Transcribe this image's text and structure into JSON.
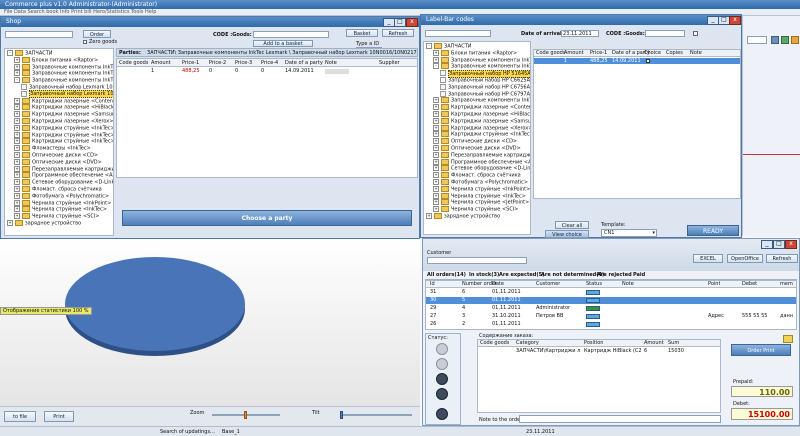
{
  "main_title": "Commerce plus v1.0  Administrator-(Administrator)",
  "main_menu": "File  Data  Search book  Info  Print bill  Hero/Statistics  Tools  Help",
  "shop": {
    "title": "Shop",
    "order_btn": "Order",
    "zero_goods": "Zero goods",
    "code_label": "CODE :Goods:",
    "add_basket": "Add to a basket",
    "basket": "Basket",
    "refresh": "Refresh",
    "type_label": "Type a ID",
    "type_value": "12345",
    "parties_label": "Parties:",
    "path": "ЗАПЧАСТИ\\ Заправочные компоненты InkTec Lexmark \\ Заправочный набор Lexmark 10N0016/10N0217 InkTec (черный) 2x",
    "columns": [
      "Code goods",
      "Amount",
      "Price-1",
      "Price-2",
      "Price-3",
      "Price-4",
      "Date of a party",
      "Note",
      "Supplier"
    ],
    "row": [
      "1",
      "",
      "488,25",
      "0",
      "0",
      "0",
      "14.09.2011",
      "",
      ""
    ],
    "choose_party": "Choose a party",
    "tree": [
      {
        "label": "ЗАПЧАСТИ",
        "level": 0,
        "exp": "-"
      },
      {
        "label": "Блоки питания <Raptor>",
        "level": 1,
        "exp": "+"
      },
      {
        "label": "Заправочные компоненты InkTec <Can",
        "level": 1,
        "exp": "+"
      },
      {
        "label": "Заправочные компоненты InkTec <HP>",
        "level": 1,
        "exp": "+"
      },
      {
        "label": "Заправочные компоненты InkTec <Lexm",
        "level": 1,
        "exp": "-"
      },
      {
        "label": "Заправочный набор Lexmark 10N001",
        "level": 2,
        "exp": ""
      },
      {
        "label": "Заправочный набор Lexmark 10N001",
        "level": 2,
        "exp": "",
        "selected": true
      },
      {
        "label": "Картриджи лазерные <Content>",
        "level": 1,
        "exp": "+"
      },
      {
        "label": "Картриджи лазерные <HiBlack>",
        "level": 1,
        "exp": "+"
      },
      {
        "label": "Картриджи лазерные <Samsung>",
        "level": 1,
        "exp": "+"
      },
      {
        "label": "Картриджи лазерные <Xerox>",
        "level": 1,
        "exp": "+"
      },
      {
        "label": "Картриджи струйные <InkTec>",
        "level": 1,
        "exp": "+"
      },
      {
        "label": "Картриджи струйные <InkTec>",
        "level": 1,
        "exp": "+"
      },
      {
        "label": "Картриджи струйные <InkTec>",
        "level": 1,
        "exp": "+"
      },
      {
        "label": "Фломастеры <InkTec>",
        "level": 1,
        "exp": "+"
      },
      {
        "label": "Оптические диски <CD>",
        "level": 1,
        "exp": "+"
      },
      {
        "label": "Оптические диски <DVD>",
        "level": 1,
        "exp": "+"
      },
      {
        "label": "Перезаправляемые картриджи <Epson",
        "level": 1,
        "exp": "+"
      },
      {
        "label": "Программное обеспечение <Антивирусы",
        "level": 1,
        "exp": "+"
      },
      {
        "label": "Сетевое оборудование <D-Link>",
        "level": 1,
        "exp": "+"
      },
      {
        "label": "Фломаст. сброса счётчика",
        "level": 1,
        "exp": "+"
      },
      {
        "label": "Фотобумага <Polychromatic>",
        "level": 1,
        "exp": "+"
      },
      {
        "label": "Чернила струйные <InkPoint>",
        "level": 1,
        "exp": "+"
      },
      {
        "label": "Чернила струйные <InkTec>",
        "level": 1,
        "exp": "+"
      },
      {
        "label": "Чернила струйные <SCI>",
        "level": 1,
        "exp": "+"
      },
      {
        "label": "зарядное устройство",
        "level": 0,
        "exp": "+"
      }
    ]
  },
  "label": {
    "title": "Label-Bar codes",
    "date_label": "Date of arrival",
    "date_value": "23.11.2011",
    "code_label": "CODE :Goods:",
    "columns": [
      "Code goods",
      "Amount",
      "Price-1",
      "Date of a party",
      "Choice",
      "Copies",
      "Note"
    ],
    "row": [
      "1",
      "1",
      "488,25",
      "14.09.2011",
      "",
      "",
      ""
    ],
    "clear_all": "Clear all",
    "view_choice": "View choice",
    "template_label": "Template:",
    "template_value": "CN1",
    "ready": "READY",
    "tree": [
      {
        "label": "ЗАПЧАСТИ",
        "level": 0,
        "exp": "-"
      },
      {
        "label": "Блоки питания <Raptor>",
        "level": 1,
        "exp": "+"
      },
      {
        "label": "Заправочные компоненты InkTec <Car",
        "level": 1,
        "exp": "+"
      },
      {
        "label": "Заправочные компоненты InkTec <HP>",
        "level": 1,
        "exp": "-"
      },
      {
        "label": "Заправочный набор HP 51645A/C6",
        "level": 2,
        "exp": "",
        "selected": true
      },
      {
        "label": "Заправочный набор HP C6625A,C8",
        "level": 2,
        "exp": ""
      },
      {
        "label": "Заправочный набор HP C6756A,C8",
        "level": 2,
        "exp": ""
      },
      {
        "label": "Заправочный набор HP C6797A,C8",
        "level": 2,
        "exp": ""
      },
      {
        "label": "Заправочные компоненты InkTec <Lexm",
        "level": 1,
        "exp": "+"
      },
      {
        "label": "Картриджи лазерные <Content>",
        "level": 1,
        "exp": "+"
      },
      {
        "label": "Картриджи лазерные <HiBlack>",
        "level": 1,
        "exp": "+"
      },
      {
        "label": "Картриджи лазерные <Samsung>",
        "level": 1,
        "exp": "+"
      },
      {
        "label": "Картриджи лазерные <Xerox>",
        "level": 1,
        "exp": "+"
      },
      {
        "label": "Картриджи струйные <InkTec>",
        "level": 1,
        "exp": "+"
      },
      {
        "label": "Оптические диски <CD>",
        "level": 1,
        "exp": "+"
      },
      {
        "label": "Оптические диски <DVD>",
        "level": 1,
        "exp": "+"
      },
      {
        "label": "Перезаправляемые картриджи <Epson",
        "level": 1,
        "exp": "+"
      },
      {
        "label": "Программное обеспечение <Антивирусы",
        "level": 1,
        "exp": "+"
      },
      {
        "label": "Сетевое оборудование <D-Link>",
        "level": 1,
        "exp": "+"
      },
      {
        "label": "Фломаст. сброса счётчика",
        "level": 1,
        "exp": "+"
      },
      {
        "label": "Фотобумага <Polychromatic>",
        "level": 1,
        "exp": "+"
      },
      {
        "label": "Чернила струйные <InkPoint>",
        "level": 1,
        "exp": "+"
      },
      {
        "label": "Чернила струйные <InkTec>",
        "level": 1,
        "exp": "+"
      },
      {
        "label": "Чернила струйные <JetPoint>",
        "level": 1,
        "exp": "+"
      },
      {
        "label": "Чернила струйные <SCI>",
        "level": 1,
        "exp": "+"
      },
      {
        "label": "зарядное устройство",
        "level": 0,
        "exp": "+"
      }
    ]
  },
  "bottom": {
    "pie_label": "Отображение статистики 100 %",
    "to_file": "to file",
    "print": "Print",
    "zoom": "Zoom",
    "tilt": "Tilt"
  },
  "orders": {
    "customer_label": "Customer",
    "excel": "EXCEL",
    "openoffice": "OpenOffice",
    "refresh": "Refresh",
    "tabs": [
      "All orders(14)",
      "In stock(3)",
      "Are expected(5)",
      "Are not determined(4)",
      "Are rejected",
      "Paid"
    ],
    "columns": [
      "Id",
      "Number order",
      "Date",
      "Customer",
      "Status",
      "Note",
      "Point",
      "Debet",
      "mem"
    ],
    "rows": [
      [
        "31",
        "6",
        "01.11.2011",
        "",
        "",
        "",
        "",
        "",
        ""
      ],
      [
        "30",
        "5",
        "01.11.2011",
        "",
        "",
        "",
        "",
        "",
        ""
      ],
      [
        "29",
        "4",
        "01.11.2011",
        "Administrator",
        "",
        "",
        "",
        "",
        ""
      ],
      [
        "27",
        "3",
        "31.10.2011",
        "Петров ВВ",
        "",
        "",
        "Адрес",
        "555 55 55",
        "данн"
      ],
      [
        "26",
        "2",
        "01.11.2011",
        "",
        "",
        "",
        "",
        "",
        ""
      ]
    ],
    "status_label": "Статус:",
    "content_label": "Содержание заказа:",
    "content_columns": [
      "Code goods",
      "Category",
      "Position",
      "Amount",
      "Sum"
    ],
    "content_row": [
      "",
      "ЗАПЧАСТИ\\Картриджи ла...",
      "Картридж HiBlack (C285) для...",
      "6",
      "15030"
    ],
    "order_print": "Order Print",
    "prepaid_label": "Prepaid:",
    "prepaid_value": "110.00",
    "debet_label": "Debet:",
    "debet_value": "15100.00",
    "note_label": "Note to the order:"
  },
  "statusbar": {
    "search": "Search of updatings...",
    "base": "Base_1",
    "date": "23.11.2011"
  }
}
